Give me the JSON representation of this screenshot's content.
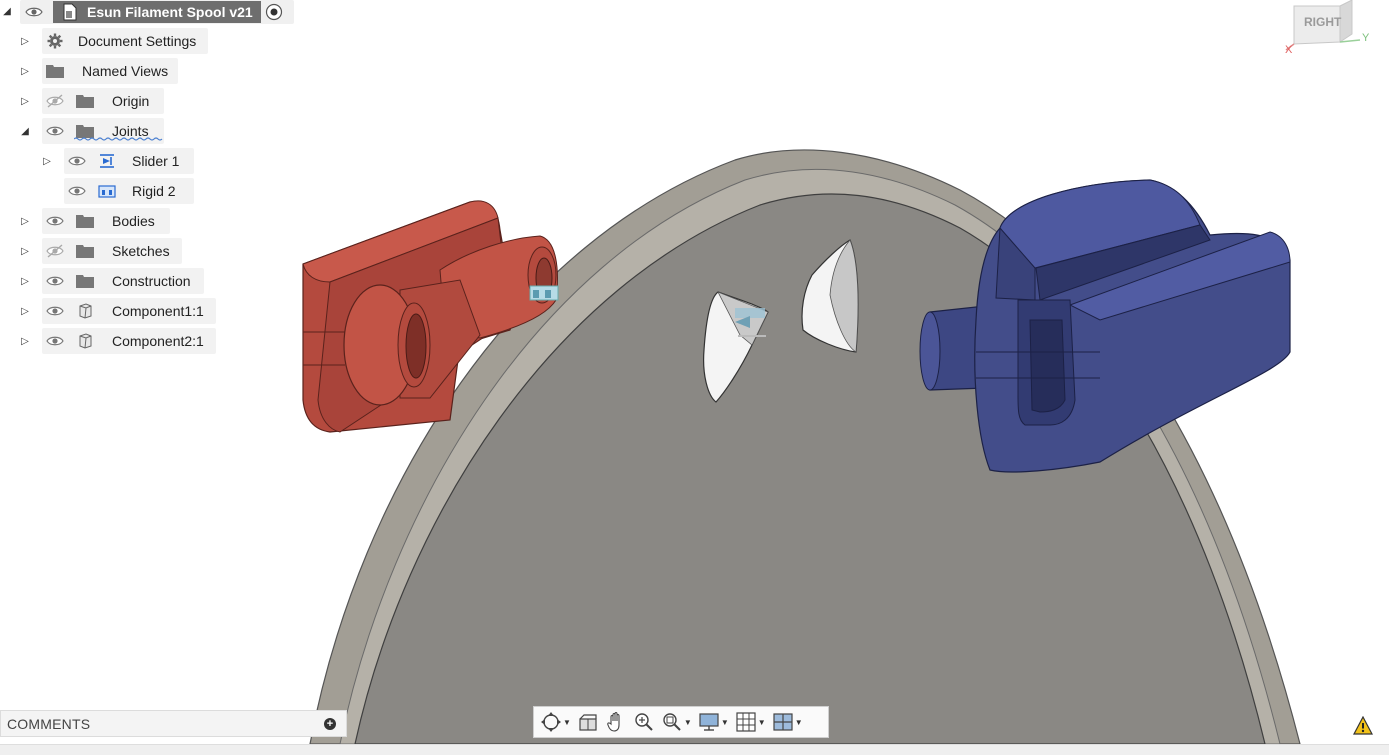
{
  "browser": {
    "root": {
      "label": "Esun Filament Spool v21",
      "icon": "document-icon"
    },
    "items": [
      {
        "label": "Document Settings",
        "icon": "gear-icon",
        "expander": "collapsed",
        "visibility": "none"
      },
      {
        "label": "Named Views",
        "icon": "folder-icon",
        "expander": "collapsed",
        "visibility": "none"
      },
      {
        "label": "Origin",
        "icon": "folder-icon",
        "expander": "collapsed",
        "visibility": "hidden"
      },
      {
        "label": "Joints",
        "icon": "folder-icon",
        "expander": "expanded",
        "visibility": "visible"
      },
      {
        "label": "Slider 1",
        "icon": "slider-joint-icon",
        "expander": "collapsed",
        "visibility": "visible",
        "child": true
      },
      {
        "label": "Rigid 2",
        "icon": "rigid-joint-icon",
        "expander": "none",
        "visibility": "visible",
        "child": true
      },
      {
        "label": "Bodies",
        "icon": "folder-icon",
        "expander": "collapsed",
        "visibility": "visible"
      },
      {
        "label": "Sketches",
        "icon": "folder-icon",
        "expander": "collapsed",
        "visibility": "hidden"
      },
      {
        "label": "Construction",
        "icon": "folder-icon",
        "expander": "collapsed",
        "visibility": "visible"
      },
      {
        "label": "Component1:1",
        "icon": "component-icon",
        "expander": "collapsed",
        "visibility": "visible"
      },
      {
        "label": "Component2:1",
        "icon": "component-icon",
        "expander": "collapsed",
        "visibility": "visible"
      }
    ]
  },
  "comments": {
    "label": "COMMENTS"
  },
  "viewcube": {
    "face": "RIGHT",
    "axis_x": "X",
    "axis_y": "Y"
  },
  "navbar": {
    "tools": [
      "orbit-icon",
      "look-at-icon",
      "pan-icon",
      "zoom-icon",
      "fit-icon",
      "display-settings-icon",
      "grid-icon",
      "viewports-icon"
    ]
  },
  "colors": {
    "red_part": "#b84a3e",
    "blue_part": "#434d8a",
    "plate": "#8c8a86",
    "plate_rim": "#a9a59c"
  }
}
